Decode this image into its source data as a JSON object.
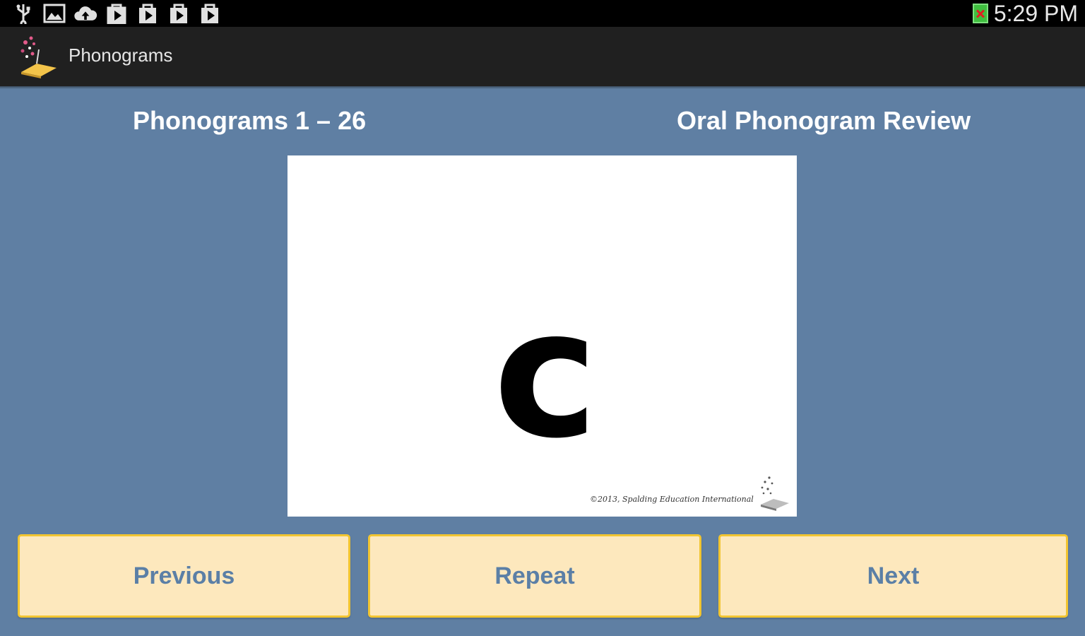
{
  "status_bar": {
    "icons": [
      "usb-icon",
      "gallery-icon",
      "cloud-upload-icon",
      "play-store-icon",
      "play-store-icon",
      "play-store-icon",
      "play-store-icon"
    ],
    "battery_icon": "battery-error-icon",
    "time": "5:29 PM"
  },
  "action_bar": {
    "app_icon": "phonograms-logo-icon",
    "title": "Phonograms"
  },
  "headers": {
    "set_label": "Phonograms 1 – 26",
    "mode_label": "Oral Phonogram Review"
  },
  "card": {
    "letter": "c",
    "copyright": "©2013, Spalding Education International",
    "logo_icon": "spalding-logo-icon"
  },
  "buttons": {
    "previous": "Previous",
    "repeat": "Repeat",
    "next": "Next"
  },
  "colors": {
    "background": "#5f7fa3",
    "button_fill": "#fde8bd",
    "button_border": "#f2c531",
    "button_text": "#5b7fa6"
  }
}
